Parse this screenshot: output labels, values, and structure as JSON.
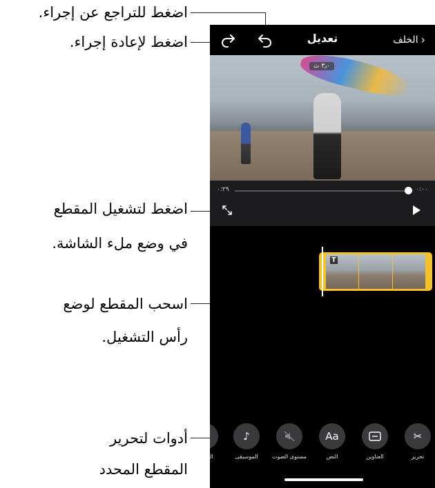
{
  "callouts": {
    "undo": "اضغط للتراجع عن إجراء.",
    "redo": "اضغط لإعادة إجراء.",
    "fullscreen_line1": "اضغط لتشغيل المقطع",
    "fullscreen_line2": "في وضع ملء الشاشة.",
    "drag_line1": "اسحب المقطع لوضع",
    "drag_line2": "رأس التشغيل.",
    "tools_line1": "أدوات لتحرير",
    "tools_line2": "المقطع المحدد"
  },
  "topbar": {
    "back_label": "الخلف",
    "title": "تعديل"
  },
  "video": {
    "duration_tag": "٣٫٠ ث"
  },
  "scrubber": {
    "current_time": "٠:٢٩",
    "end_time": "٠:٠٠",
    "progress_fraction": 0.98
  },
  "tools": [
    {
      "label": "تحرير",
      "icon": "scissors-icon"
    },
    {
      "label": "العناوين",
      "icon": "titles-icon"
    },
    {
      "label": "النص",
      "icon": "text-icon",
      "glyph": "Aa"
    },
    {
      "label": "مستوى الصوت",
      "icon": "mute-icon"
    },
    {
      "label": "الموسيقى",
      "icon": "music-note-icon",
      "glyph": "♪"
    },
    {
      "label": "الصوت",
      "icon": "sound-icon"
    }
  ]
}
